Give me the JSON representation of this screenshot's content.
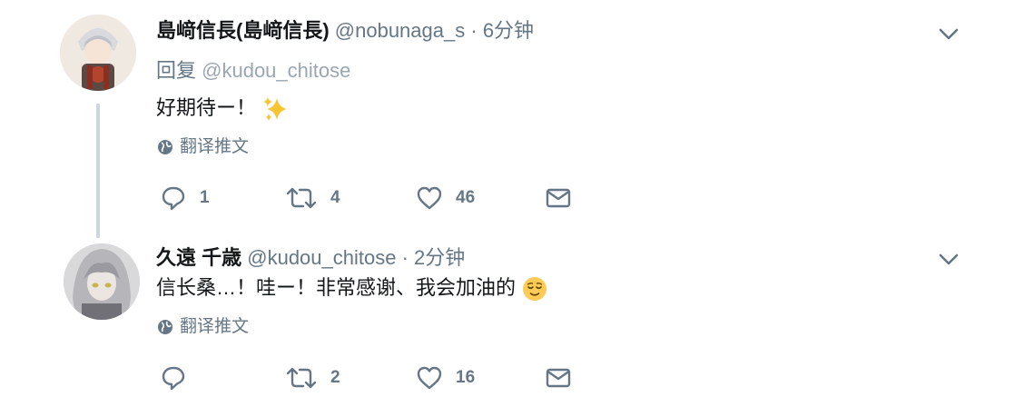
{
  "tweets": [
    {
      "display_name": "島﨑信長(島﨑信長)",
      "handle": "@nobunaga_s",
      "separator": "·",
      "time": "6分钟",
      "reply_prefix": "回复",
      "reply_to": "@kudou_chitose",
      "text": "好期待ー！",
      "emoji": "sparkles",
      "translate_label": "翻译推文",
      "replies": "1",
      "retweets": "4",
      "likes": "46"
    },
    {
      "display_name": "久遠 千歳",
      "handle": "@kudou_chitose",
      "separator": "·",
      "time": "2分钟",
      "text": "信长桑…！哇ー！非常感谢、我会加油的",
      "emoji": "relieved-face",
      "translate_label": "翻译推文",
      "replies": "",
      "retweets": "2",
      "likes": "16"
    }
  ],
  "colors": {
    "primary_text": "#14171a",
    "secondary_text": "#657786",
    "thread_line": "#ccd6dd"
  }
}
